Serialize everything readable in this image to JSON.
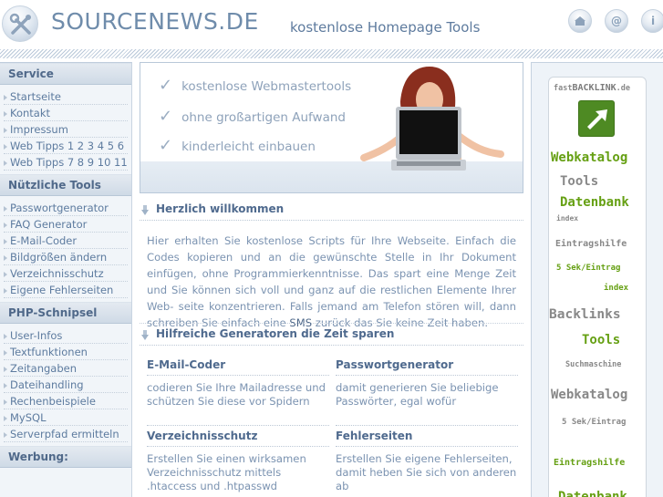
{
  "header": {
    "site_title": "SOURCENEWS.DE",
    "slogan": "kostenlose Homepage Tools",
    "buttons": [
      {
        "name": "home",
        "icon": "home-icon"
      },
      {
        "name": "contact",
        "icon": "at-icon",
        "glyph": "@"
      },
      {
        "name": "info",
        "icon": "info-icon",
        "glyph": "i"
      }
    ]
  },
  "sidebar": {
    "sections": [
      {
        "title": "Service",
        "items": [
          "Startseite",
          "Kontakt",
          "Impressum",
          "Web Tipps 1 2 3 4 5 6",
          "Web Tipps 7 8 9 10 11"
        ]
      },
      {
        "title": "Nützliche Tools",
        "items": [
          "Passwortgenerator",
          "FAQ Generator",
          "E-Mail-Coder",
          "Bildgrößen ändern",
          "Verzeichnisschutz",
          "Eigene Fehlerseiten"
        ]
      },
      {
        "title": "PHP-Schnipsel",
        "items": [
          "User-Infos",
          "Textfunktionen",
          "Zeitangaben",
          "Dateihandling",
          "Rechenbeispiele",
          "MySQL",
          "Serverpfad ermitteln"
        ]
      },
      {
        "title": "Werbung:",
        "items": []
      }
    ]
  },
  "banner": {
    "lines": [
      "kostenlose Webmastertools",
      "ohne großartigen Aufwand",
      "kinderleicht einbauen"
    ],
    "check_glyph": "✓"
  },
  "welcome": {
    "title": "Herzlich willkommen",
    "text_before": "Hier erhalten Sie kostenlose Scripts für Ihre Webseite. Einfach die Codes kopieren und an die gewünschte Stelle in Ihr Dokument einfügen, ohne Programmierkenntnisse. Das spart eine Menge Zeit und Sie können sich voll und ganz auf die restlichen Elemente Ihrer Web- seite konzentrieren. Falls jemand am Telefon stören will, dann schreiben Sie einfach eine ",
    "highlight": "SMS",
    "text_after": " zurück das Sie keine Zeit haben."
  },
  "generators": {
    "title": "Hilfreiche Generatoren die Zeit sparen",
    "tools": [
      {
        "title": "E-Mail-Coder",
        "desc": "codieren Sie Ihre Mailadresse und schützen Sie diese vor Spidern"
      },
      {
        "title": "Passwortgenerator",
        "desc": "damit generieren Sie beliebige Passwörter, egal wofür"
      },
      {
        "title": "Verzeichnisschutz",
        "desc": "Erstellen Sie einen wirksamen Verzeichnisschutz mittels .htaccess und .htpasswd"
      },
      {
        "title": "Fehlerseiten",
        "desc": "Erstellen Sie eigene Fehlerseiten, damit heben Sie sich von anderen ab"
      }
    ]
  },
  "ad": {
    "brand_prefix": "fast",
    "brand_main": "BACKLINK",
    "brand_suffix": ".de",
    "words": [
      "Webkatalog",
      "Tools",
      "Datenbank",
      "index",
      "Eintragshilfe",
      "5 Sek/Eintrag",
      "index",
      "Backlinks",
      "Tools",
      "Suchmaschine",
      "Webkatalog",
      "5 Sek/Eintrag",
      "Eintragshilfe",
      "Datenbank"
    ],
    "colors": {
      "green": "#66a014",
      "gray": "#888888"
    }
  }
}
